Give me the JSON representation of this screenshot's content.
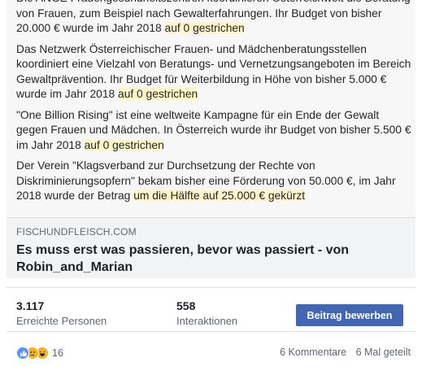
{
  "preview": {
    "paragraphs": [
      {
        "text": "Die ANGE Frauengesundheitszentren koordinieren Österreichweit die Beratung von Frauen, zum Beispiel nach Gewalterfahrungen. Ihr Budget von bisher 20.000 € wurde im Jahr 2018 ",
        "highlight": "auf 0 gestrichen"
      },
      {
        "text": "Das Netzwerk Österreichischer Frauen- und Mädchenberatungsstellen koordiniert eine Vielzahl von Beratungs- und Vernetzungsangeboten im Bereich Gewaltprävention. Ihr Budget für Weiterbildung in Höhe von bisher 5.000 € wurde im Jahr 2018 ",
        "highlight": "auf 0 gestrichen"
      },
      {
        "text": "\"One Billion Rising\" ist eine weltweite Kampagne für ein Ende der Gewalt gegen Frauen und Mädchen. In Österreich wurde ihr Budget von bisher 5.500 € im Jahr 2018 ",
        "highlight": "auf 0 gestrichen"
      },
      {
        "text": "Der Verein \"Klagsverband zur Durchsetzung der Rechte von Diskriminierungsopfern\" bekam bisher eine Förderung von 50.000 €, im Jahr 2018 wurde der Betrag ",
        "highlight": "um die Hälfte auf 25.000 € gekürzt"
      }
    ]
  },
  "link": {
    "domain": "FISCHUNDFLEISCH.COM",
    "headline": "Es muss erst was passieren, bevor was passiert - von Robin_and_Marian"
  },
  "stats": {
    "reach_value": "3.117",
    "reach_label": "Erreichte Personen",
    "interactions_value": "558",
    "interactions_label": "Interaktionen",
    "boost_label": "Beitrag bewerben"
  },
  "footer": {
    "reaction_icons": [
      "like-icon",
      "sad-icon",
      "haha-icon"
    ],
    "reaction_count": "16",
    "comments": "6 Kommentare",
    "shares": "6 Mal geteilt"
  },
  "colors": {
    "highlight": "#fdf6c8",
    "boost_button": "#4267b2",
    "like": "#5890ff",
    "emoji": "#f7b125"
  }
}
